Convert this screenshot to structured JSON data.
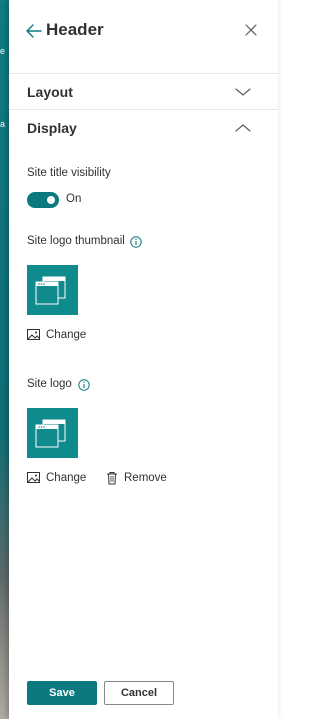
{
  "header": {
    "title": "Header"
  },
  "background": {
    "fragment_1": "e",
    "fragment_2": "a"
  },
  "sections": {
    "layout": {
      "label": "Layout",
      "expanded": false
    },
    "display": {
      "label": "Display",
      "expanded": true
    }
  },
  "display": {
    "site_title_visibility": {
      "label": "Site title visibility",
      "state": "On",
      "value": true
    },
    "site_logo_thumbnail": {
      "label": "Site logo thumbnail",
      "change_label": "Change"
    },
    "site_logo": {
      "label": "Site logo",
      "change_label": "Change",
      "remove_label": "Remove"
    }
  },
  "footer": {
    "save_label": "Save",
    "cancel_label": "Cancel"
  },
  "colors": {
    "accent": "#0b7a80",
    "thumbnail_bg": "#0f8b8d",
    "text": "#323130",
    "divider": "#e6e6e6"
  },
  "icons": {
    "back": "arrow-left-icon",
    "close": "close-icon",
    "layout_chevron": "chevron-down-icon",
    "display_chevron": "chevron-up-icon",
    "info": "info-icon",
    "image": "image-icon",
    "trash": "trash-icon"
  }
}
